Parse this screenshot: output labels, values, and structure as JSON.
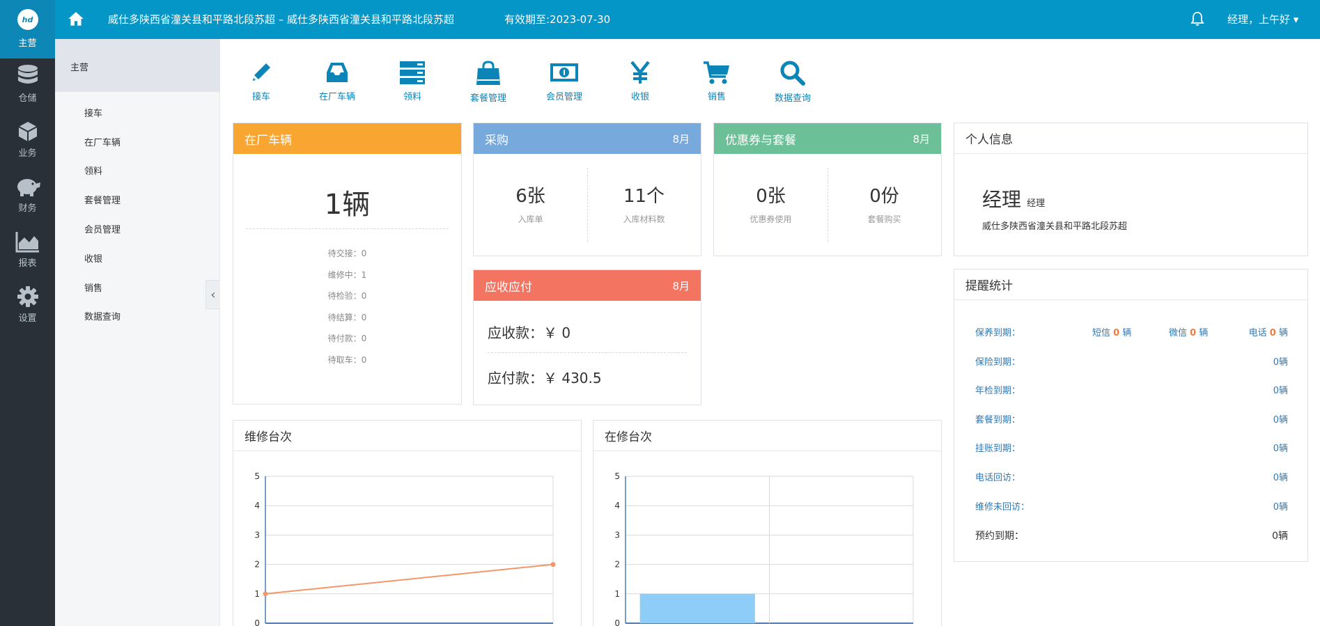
{
  "header": {
    "logo_text": "hd",
    "title": "威仕多陕西省潼关县和平路北段苏超 – 威仕多陕西省潼关县和平路北段苏超",
    "expire": "有效期至:2023-07-30",
    "user": "经理，上午好",
    "user_dropdown": "▾"
  },
  "darkbar": {
    "active": "主营",
    "items": [
      {
        "label": "仓储",
        "icon": "database-icon"
      },
      {
        "label": "业务",
        "icon": "cube-icon"
      },
      {
        "label": "财务",
        "icon": "piggy-bank-icon"
      },
      {
        "label": "报表",
        "icon": "area-chart-icon"
      },
      {
        "label": "设置",
        "icon": "gear-icon"
      }
    ]
  },
  "subbar": {
    "heading": "主营",
    "items": [
      "接车",
      "在厂车辆",
      "领料",
      "套餐管理",
      "会员管理",
      "收银",
      "销售",
      "数据查询"
    ],
    "collapse": "‹"
  },
  "quick": [
    {
      "label": "接车",
      "icon": "pencil-icon"
    },
    {
      "label": "在厂车辆",
      "icon": "inbox-icon"
    },
    {
      "label": "领料",
      "icon": "server-icon"
    },
    {
      "label": "套餐管理",
      "icon": "shopping-bag-icon"
    },
    {
      "label": "会员管理",
      "icon": "money-icon"
    },
    {
      "label": "收银",
      "icon": "yen-icon"
    },
    {
      "label": "销售",
      "icon": "cart-icon"
    },
    {
      "label": "数据查询",
      "icon": "search-icon"
    }
  ],
  "vehicles": {
    "title": "在厂车辆",
    "count": "1辆",
    "stats": [
      "待交接：0",
      "维修中：1",
      "待检验：0",
      "待结算：0",
      "待付款：0",
      "待取车：0"
    ]
  },
  "purchase": {
    "title": "采购",
    "month": "8月",
    "a_value": "6张",
    "a_label": "入库单",
    "b_value": "11个",
    "b_label": "入库材料数"
  },
  "coupon": {
    "title": "优惠券与套餐",
    "month": "8月",
    "a_value": "0张",
    "a_label": "优惠券使用",
    "b_value": "0份",
    "b_label": "套餐购买"
  },
  "profile": {
    "title": "个人信息",
    "name": "经理",
    "role": "经理",
    "store": "威仕多陕西省潼关县和平路北段苏超"
  },
  "finance": {
    "title": "应收应付",
    "month": "8月",
    "receivable": "应收款：￥ 0",
    "payable": "应付款：￥ 430.5"
  },
  "reminders": {
    "title": "提醒统计",
    "maintenance": {
      "label": "保养到期：",
      "sms": "短信",
      "wechat": "微信",
      "phone": "电话",
      "sms_n": "0",
      "wechat_n": "0",
      "phone_n": "0",
      "unit": "辆"
    },
    "rows": [
      {
        "label": "保险到期：",
        "value": "0辆"
      },
      {
        "label": "年检到期：",
        "value": "0辆"
      },
      {
        "label": "套餐到期：",
        "value": "0辆"
      },
      {
        "label": "挂账到期：",
        "value": "0辆"
      },
      {
        "label": "电话回访：",
        "value": "0辆"
      },
      {
        "label": "维修未回访：",
        "value": "0辆"
      }
    ],
    "appointment": {
      "label": "预约到期：",
      "value": "0辆"
    }
  },
  "colors": {
    "header": "#0496c7",
    "vehicles": "#f9a531",
    "purchase": "#77a9dd",
    "coupon": "#6cc097",
    "finance": "#f47462",
    "line": "#f4956a",
    "bar": "#8ecdf8"
  },
  "chart_data": [
    {
      "type": "line",
      "title": "维修台次",
      "x": [
        0,
        1
      ],
      "series": [
        {
          "values": [
            1,
            2
          ]
        }
      ],
      "ylim": [
        0,
        5
      ],
      "yticks": [
        "0",
        "1",
        "2",
        "3",
        "4",
        "5"
      ],
      "grid": true
    },
    {
      "type": "bar",
      "title": "在修台次",
      "categories": [
        "",
        ""
      ],
      "values": [
        1,
        0
      ],
      "ylim": [
        0,
        5
      ],
      "yticks": [
        "0",
        "1",
        "2",
        "3",
        "4",
        "5"
      ],
      "grid": true
    }
  ]
}
